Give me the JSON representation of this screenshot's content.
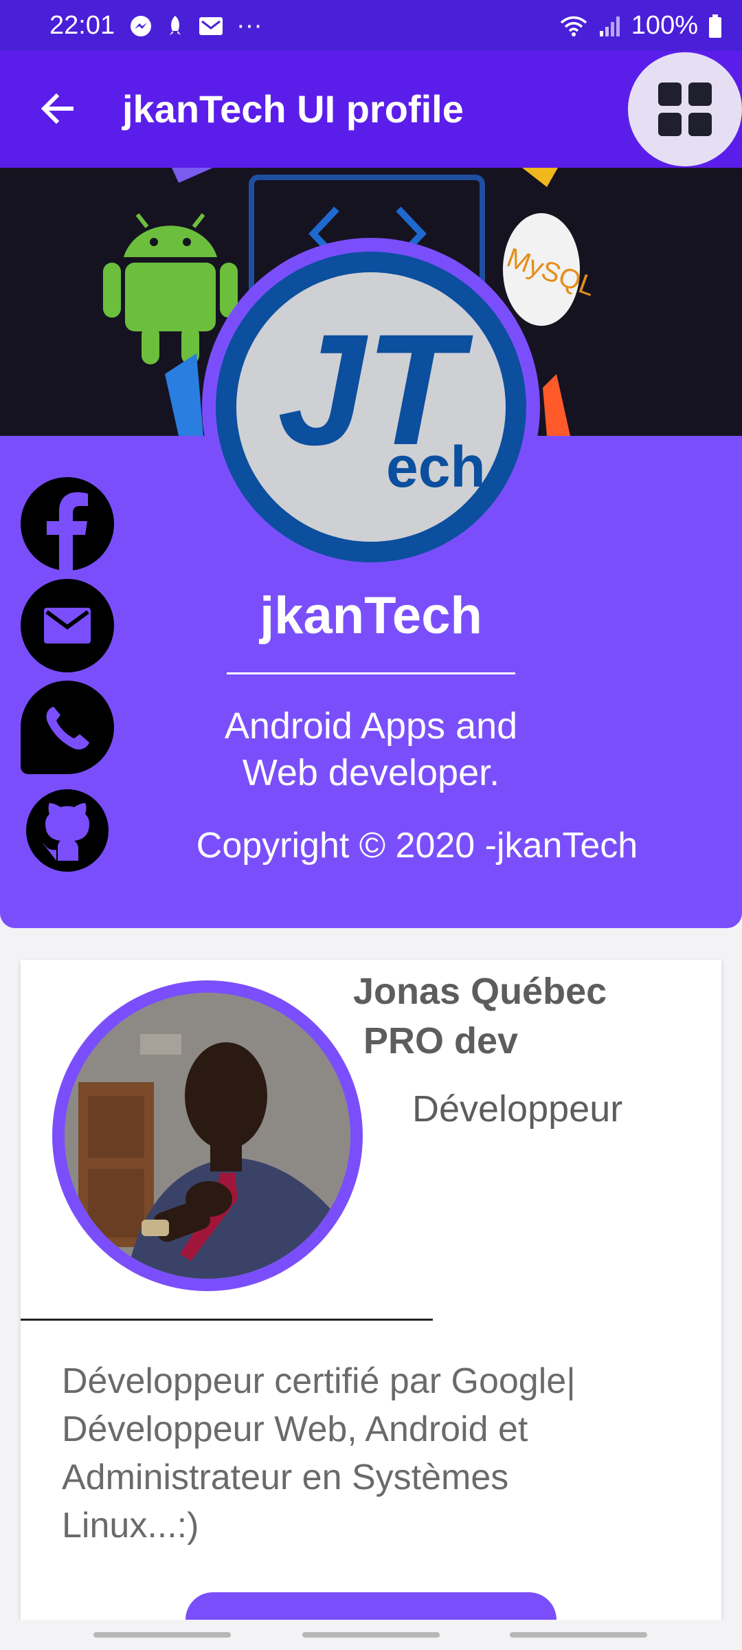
{
  "status_bar": {
    "time": "22:01",
    "battery": "100%",
    "more": "···",
    "icons": [
      "messenger-icon",
      "rocket-icon",
      "mail-icon",
      "wifi-icon",
      "signal-icon",
      "battery-icon"
    ]
  },
  "app_bar": {
    "title": "jkanTech UI profile",
    "back_icon": "arrow-back-icon",
    "menu_icon": "grid-icon"
  },
  "profile": {
    "name": "jkanTech",
    "tagline": "Android Apps and\nWeb developer.",
    "copyright": "Copyright © 2020 -jkanTech",
    "logo_text_big": "JT",
    "logo_text_small": "ech"
  },
  "banner": {
    "mysql_label": "MySQL"
  },
  "social_links": [
    {
      "icon": "facebook-icon"
    },
    {
      "icon": "mail-icon"
    },
    {
      "icon": "whatsapp-icon"
    },
    {
      "icon": "github-icon"
    }
  ],
  "card": {
    "name_line1": "Jonas Québec",
    "name_line2": " PRO dev",
    "role": "Développeur",
    "description": "Développeur certifié par Google|\n Développeur   Web, Android et\nAdministrateur en Systèmes\nLinux...:)"
  },
  "colors": {
    "status_bar": "#4a1fd8",
    "app_bar": "#5b1eea",
    "accent": "#7a4ffb",
    "logo_blue": "#0b4f9e"
  }
}
